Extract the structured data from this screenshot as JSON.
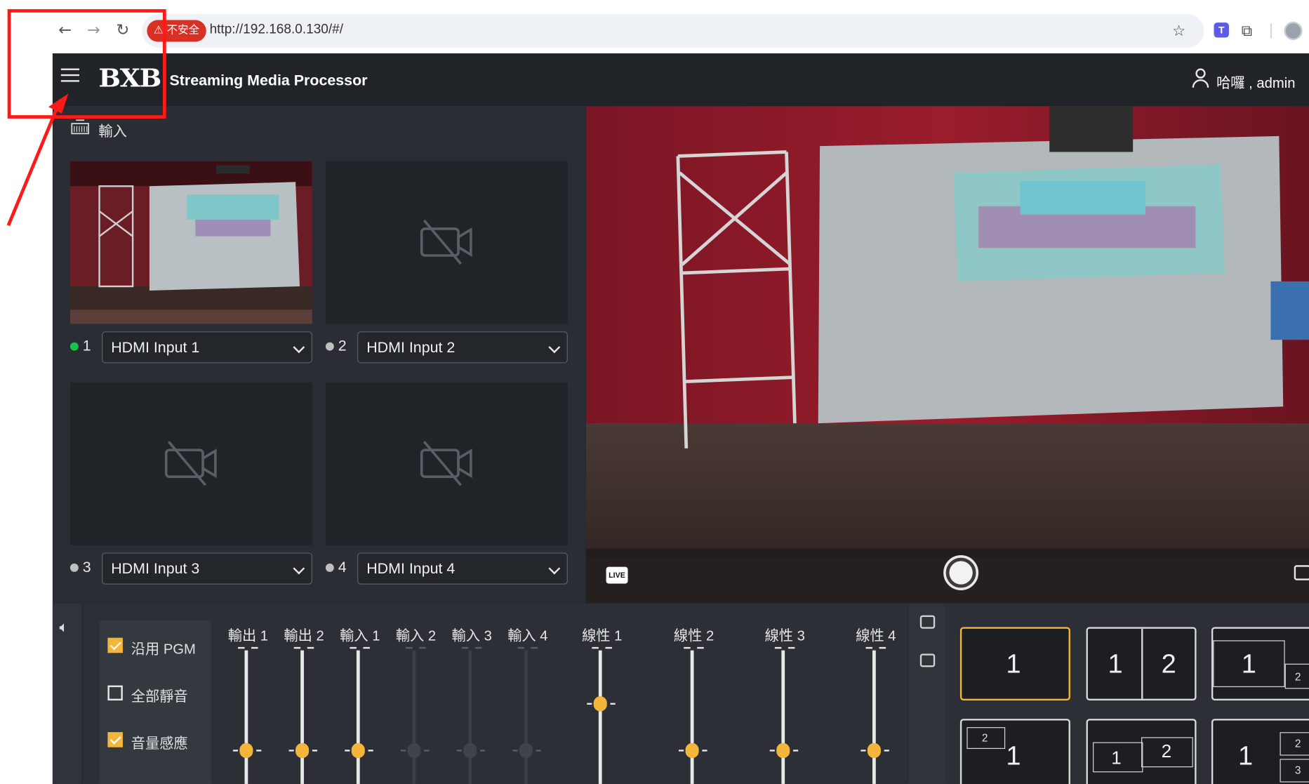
{
  "browser": {
    "back_icon": "arrow-left-icon",
    "forward_icon": "arrow-right-icon",
    "reload_icon": "reload-icon",
    "security_label": "⚠ 不安全",
    "url": "http://192.168.0.130/#/",
    "bookmark_icon": "star-icon",
    "extension_icon_label": "T"
  },
  "header": {
    "logo_text": "BXB",
    "title": "Streaming Media Processor",
    "greeting": "哈囉 , admin"
  },
  "inputs": {
    "section_label": "輸入",
    "sources": [
      {
        "number": "1",
        "selected": "HDMI Input 1",
        "active": true
      },
      {
        "number": "2",
        "selected": "HDMI Input 2",
        "active": false
      },
      {
        "number": "3",
        "selected": "HDMI Input 3",
        "active": false
      },
      {
        "number": "4",
        "selected": "HDMI Input 4",
        "active": false
      }
    ]
  },
  "preview": {
    "live_label": "LIVE"
  },
  "audio": {
    "options": [
      {
        "label": "沿用 PGM",
        "checked": true
      },
      {
        "label": "全部靜音",
        "checked": false
      },
      {
        "label": "音量感應",
        "checked": true
      }
    ],
    "channels": [
      {
        "label": "輸出 1",
        "enabled": true,
        "level": 0.2
      },
      {
        "label": "輸出 2",
        "enabled": true,
        "level": 0.2
      },
      {
        "label": "輸入 1",
        "enabled": true,
        "level": 0.2
      },
      {
        "label": "輸入 2",
        "enabled": false,
        "level": 0.2
      },
      {
        "label": "輸入 3",
        "enabled": false,
        "level": 0.2
      },
      {
        "label": "輸入 4",
        "enabled": false,
        "level": 0.2
      },
      {
        "label": "線性 1",
        "enabled": true,
        "level": 0.55
      },
      {
        "label": "線性 2",
        "enabled": true,
        "level": 0.2
      },
      {
        "label": "線性 3",
        "enabled": true,
        "level": 0.2
      },
      {
        "label": "線性 4",
        "enabled": true,
        "level": 0.2
      }
    ]
  },
  "layouts": {
    "items": [
      {
        "type": "single",
        "labels": [
          "1"
        ],
        "selected": true
      },
      {
        "type": "split",
        "labels": [
          "1",
          "2"
        ],
        "selected": false
      },
      {
        "type": "pip-br",
        "labels": [
          "1",
          "2"
        ],
        "selected": false
      },
      {
        "type": "pip-tl",
        "labels": [
          "2",
          "1"
        ],
        "selected": false
      },
      {
        "type": "side-by-side",
        "labels": [
          "1",
          "2"
        ],
        "selected": false
      },
      {
        "type": "main-two",
        "labels": [
          "1",
          "2",
          "3"
        ],
        "selected": false
      }
    ]
  },
  "colors": {
    "accent": "#f3b63a",
    "active_dot": "#1bc24b",
    "annotation": "#ff1a1a"
  }
}
